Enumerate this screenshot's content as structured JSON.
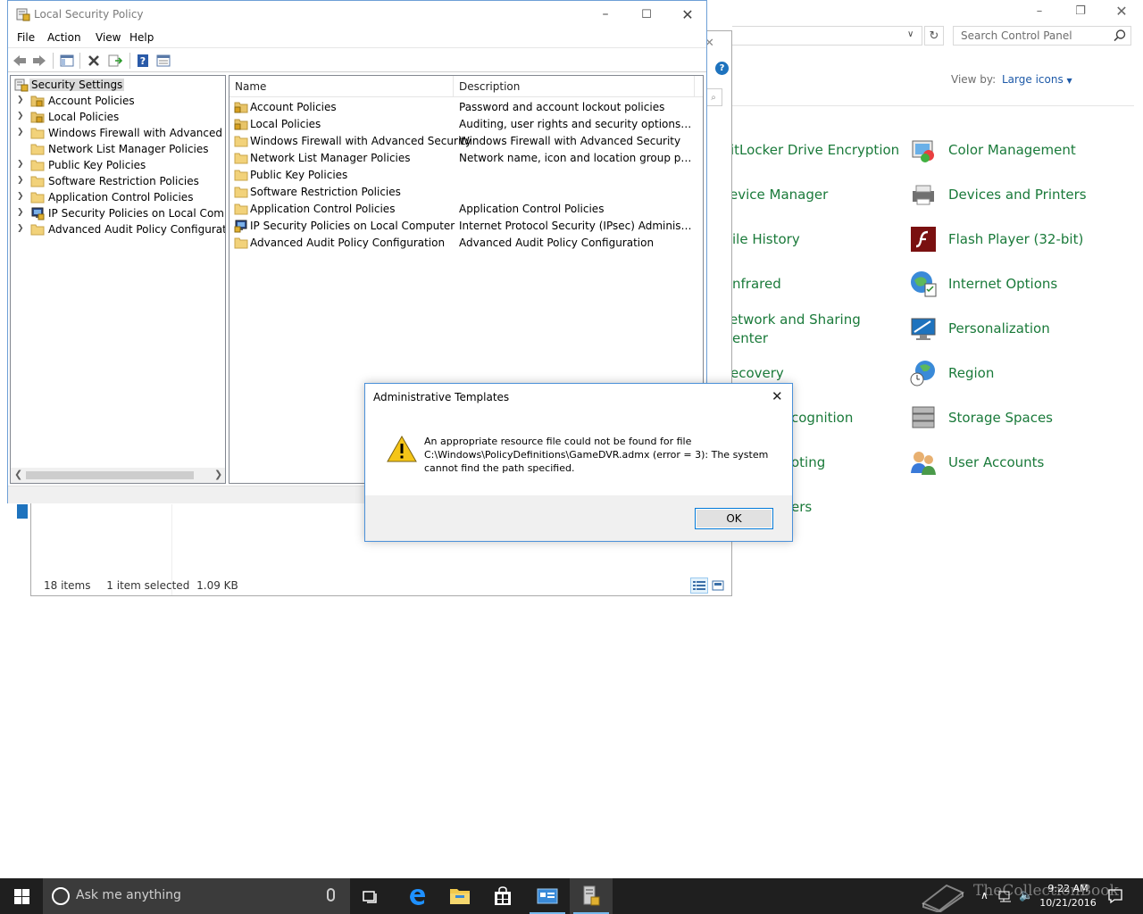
{
  "control_panel": {
    "search_placeholder": "Search Control Panel",
    "view_by_label": "View by:",
    "view_by_value": "Large icons",
    "items_left": [
      "itLocker Drive Encryption",
      "evice Manager",
      "ile History",
      "nfrared",
      "etwork and Sharing",
      "enter",
      "ecovery",
      "cognition",
      "oting",
      "ers"
    ],
    "items_right": [
      "Color Management",
      "Devices and Printers",
      "Flash Player (32-bit)",
      "Internet Options",
      "Personalization",
      "Region",
      "Storage Spaces",
      "User Accounts"
    ]
  },
  "explorer": {
    "status_items": "18 items",
    "status_selected": "1 item selected",
    "status_size": "1.09 KB"
  },
  "lsp": {
    "title": "Local Security Policy",
    "menu": [
      "File",
      "Action",
      "View",
      "Help"
    ],
    "tree_root": "Security Settings",
    "tree": [
      "Account Policies",
      "Local Policies",
      "Windows Firewall with Advanced Secu",
      "Network List Manager Policies",
      "Public Key Policies",
      "Software Restriction Policies",
      "Application Control Policies",
      "IP Security Policies on Local Compute",
      "Advanced Audit Policy Configuration"
    ],
    "columns": {
      "name": "Name",
      "description": "Description"
    },
    "rows": [
      {
        "name": "Account Policies",
        "desc": "Password and account lockout policies"
      },
      {
        "name": "Local Policies",
        "desc": "Auditing, user rights and security options polici..."
      },
      {
        "name": "Windows Firewall with Advanced Security",
        "desc": "Windows Firewall with Advanced Security"
      },
      {
        "name": "Network List Manager Policies",
        "desc": "Network name, icon and location group policies."
      },
      {
        "name": "Public Key Policies",
        "desc": ""
      },
      {
        "name": "Software Restriction Policies",
        "desc": ""
      },
      {
        "name": "Application Control Policies",
        "desc": "Application Control Policies"
      },
      {
        "name": "IP Security Policies on Local Computer",
        "desc": "Internet Protocol Security (IPsec) Administratio..."
      },
      {
        "name": "Advanced Audit Policy Configuration",
        "desc": "Advanced Audit Policy Configuration"
      }
    ]
  },
  "dialog": {
    "title": "Administrative Templates",
    "message_line1": "An appropriate resource file could not be found for file",
    "message_line2": "C:\\Windows\\PolicyDefinitions\\GameDVR.admx (error = 3): The system",
    "message_line3": "cannot find the path specified.",
    "ok_label": "OK"
  },
  "taskbar": {
    "search_placeholder": "Ask me anything",
    "time": "9:22 AM",
    "date": "10/21/2016",
    "watermark": "TheCollectionBook"
  }
}
